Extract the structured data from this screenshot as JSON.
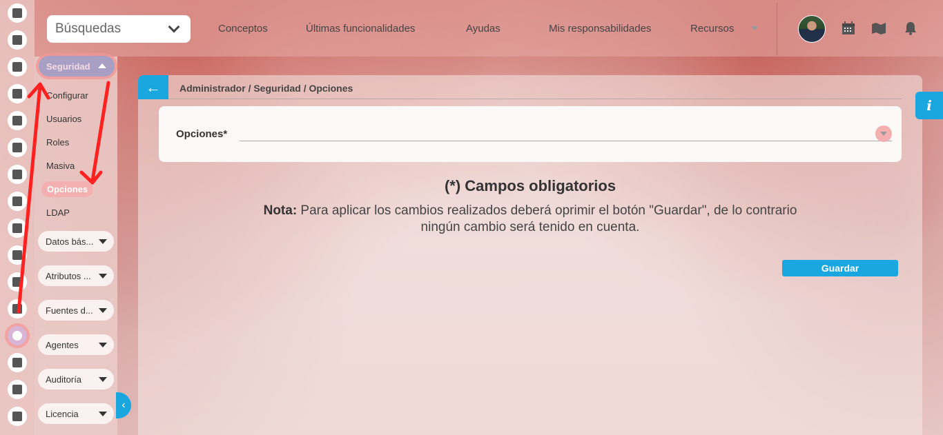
{
  "topbar": {
    "search_label": "Búsquedas",
    "nav": [
      "Conceptos",
      "Últimas funcionalidades",
      "Ayudas",
      "Mis responsabilidades",
      "Recursos"
    ]
  },
  "sidebar": {
    "section_label": "Seguridad",
    "sub_items": [
      "Configurar",
      "Usuarios",
      "Roles",
      "Masiva",
      "Opciones",
      "LDAP"
    ],
    "groups": [
      "Datos bás...",
      "Atributos ...",
      "Fuentes d...",
      "Agentes",
      "Auditoría",
      "Licencia"
    ]
  },
  "main": {
    "breadcrumb": "Administrador / Seguridad / Opciones",
    "field_label": "Opciones*",
    "required_notice": "(*) Campos obligatorios",
    "note_label": "Nota:",
    "note_text": " Para aplicar los cambios realizados deberá oprimir el botón \"Guardar\", de lo contrario ningún cambio será tenido en cuenta.",
    "save_label": "Guardar",
    "info_label": "i"
  },
  "colors": {
    "accent": "#1aa7e0",
    "annotation": "#ff2020"
  }
}
